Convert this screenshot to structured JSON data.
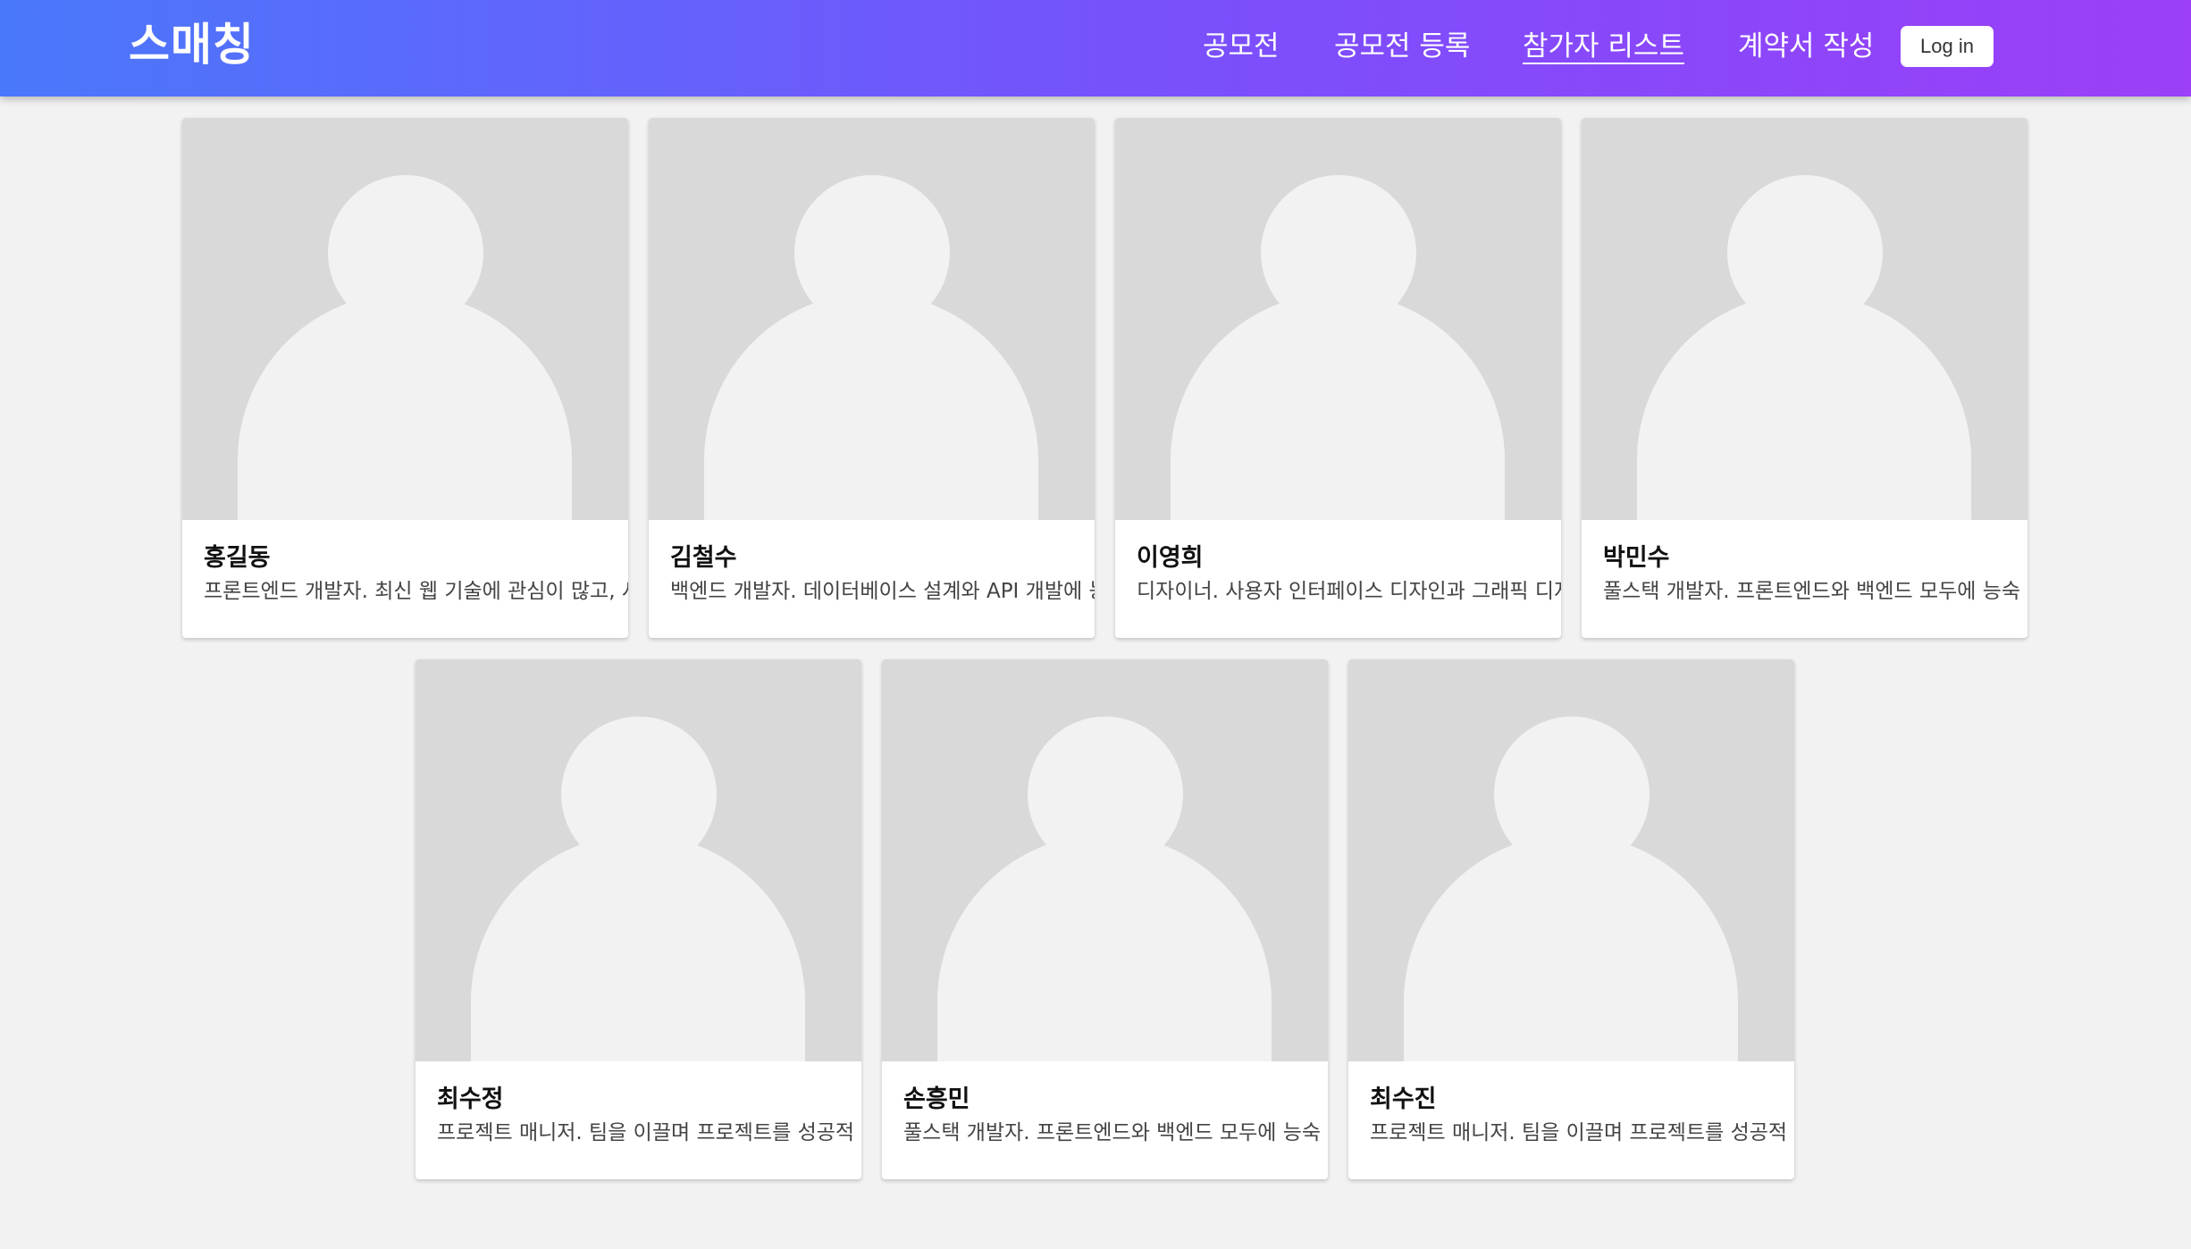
{
  "header": {
    "logo": "스매칭",
    "nav": [
      {
        "label": "공모전",
        "active": false
      },
      {
        "label": "공모전 등록",
        "active": false
      },
      {
        "label": "참가자 리스트",
        "active": true
      },
      {
        "label": "계약서 작성",
        "active": false
      }
    ],
    "login_label": "Log in",
    "colors": {
      "gradient_start": "#4a78fb",
      "gradient_end": "#9b3ff8"
    }
  },
  "avatar_icon": "person-placeholder-icon",
  "participants": [
    {
      "name": "홍길동",
      "description": "프론트엔드 개발자. 최신 웹 기술에 관심이 많고, 사"
    },
    {
      "name": "김철수",
      "description": "백엔드 개발자. 데이터베이스 설계와 API 개발에 능"
    },
    {
      "name": "이영희",
      "description": "디자이너. 사용자 인터페이스 디자인과 그래픽 디자"
    },
    {
      "name": "박민수",
      "description": "풀스택 개발자. 프론트엔드와 백엔드 모두에 능숙"
    },
    {
      "name": "최수정",
      "description": "프로젝트 매니저. 팀을 이끌며 프로젝트를 성공적"
    },
    {
      "name": "손흥민",
      "description": "풀스택 개발자. 프론트엔드와 백엔드 모두에 능숙"
    },
    {
      "name": "최수진",
      "description": "프로젝트 매니저. 팀을 이끌며 프로젝트를 성공적"
    }
  ]
}
